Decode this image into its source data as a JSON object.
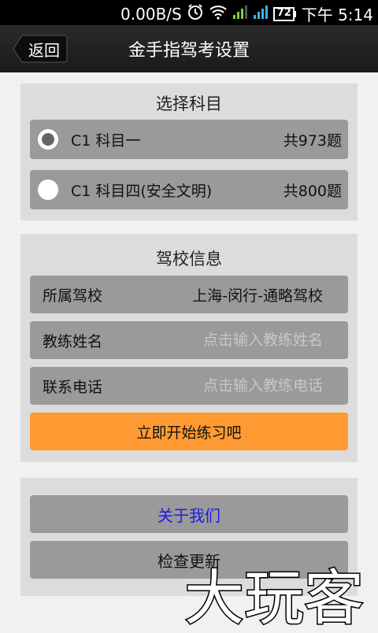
{
  "status_bar": {
    "speed": "0.00B/S",
    "battery": "72",
    "time": "下午 5:14"
  },
  "header": {
    "back_label": "返回",
    "title": "金手指驾考设置"
  },
  "subject_section": {
    "title": "选择科目",
    "options": [
      {
        "label": "C1 科目一",
        "count": "共973题",
        "selected": true
      },
      {
        "label": "C1 科目四(安全文明)",
        "count": "共800题",
        "selected": false
      }
    ]
  },
  "school_section": {
    "title": "驾校信息",
    "school_label": "所属驾校",
    "school_value": "上海-闵行-通略驾校",
    "coach_label": "教练姓名",
    "coach_placeholder": "点击输入教练姓名",
    "phone_label": "联系电话",
    "phone_placeholder": "点击输入教练电话",
    "start_label": "立即开始练习吧"
  },
  "more_section": {
    "about_label": "关于我们",
    "update_label": "检查更新"
  },
  "watermark": "大玩客",
  "colors": {
    "accent_orange": "#ff9a33",
    "link_blue": "#1a1aee",
    "row_gray": "#9a9a9a",
    "panel_gray": "#dcdcdc"
  }
}
